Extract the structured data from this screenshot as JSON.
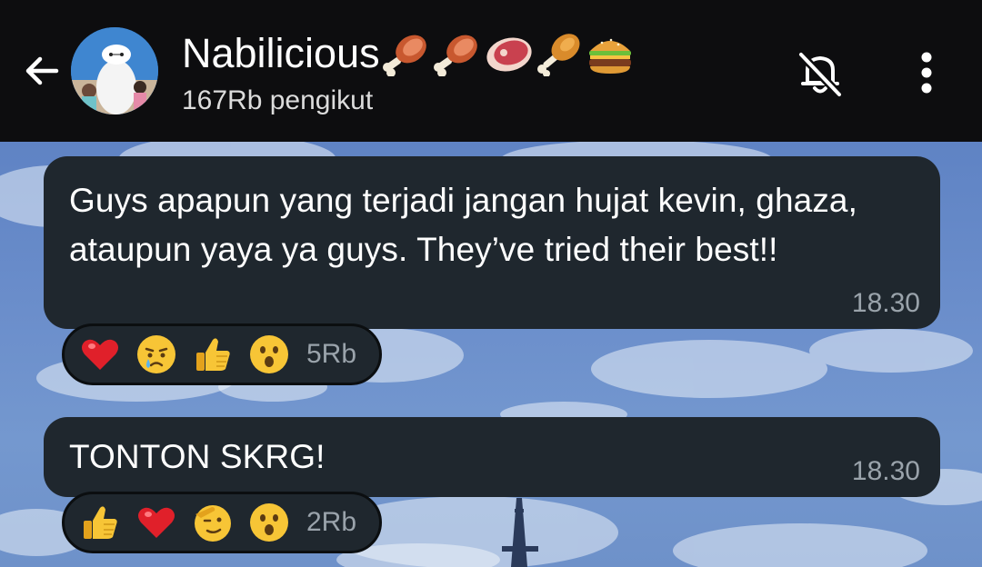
{
  "header": {
    "channel_name": "Nabilicious",
    "name_emojis": [
      "meat-on-bone",
      "meat-on-bone",
      "cut-of-meat",
      "poultry-leg",
      "hamburger"
    ],
    "followers": "167Rb pengikut",
    "icons": {
      "back": "arrow-left-icon",
      "mute": "bell-off-icon",
      "menu": "more-vertical-icon"
    }
  },
  "messages": [
    {
      "text": "Guys apapun yang terjadi jangan hujat kevin, ghaza, ataupun yaya ya guys. They’ve tried their best!!",
      "time": "18.30",
      "reactions": [
        "red-heart",
        "sad-but-relieved-face",
        "thumbs-up",
        "hushed-face"
      ],
      "reaction_count": "5Rb"
    },
    {
      "text": "TONTON SKRG!",
      "time": "18.30",
      "reactions": [
        "thumbs-up",
        "red-heart",
        "saluting-face",
        "hushed-face"
      ],
      "reaction_count": "2Rb"
    }
  ],
  "colors": {
    "header_bg": "#0d0d0f",
    "bubble_bg": "#1f272e",
    "text": "#ffffff",
    "muted_text": "#9aa3ab"
  }
}
